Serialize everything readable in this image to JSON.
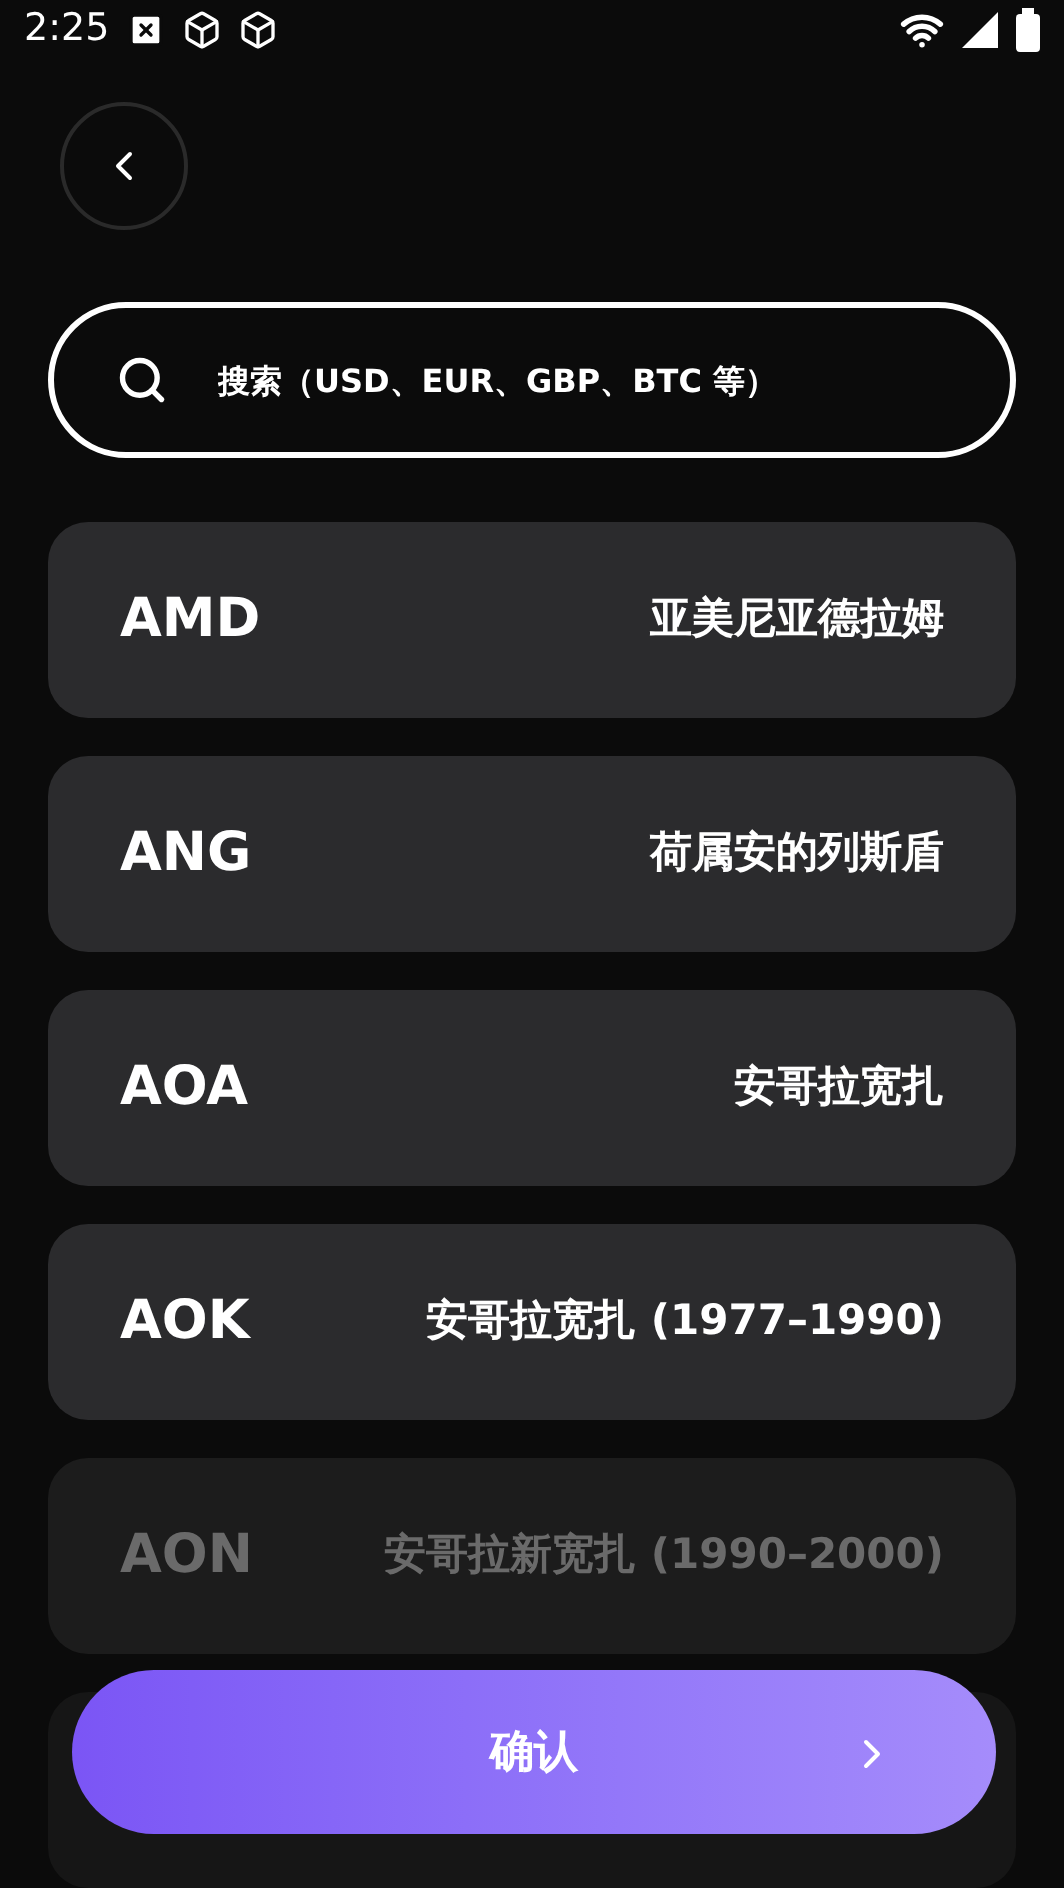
{
  "status_bar": {
    "time": "2:25"
  },
  "search": {
    "placeholder": "搜索（USD、EUR、GBP、BTC 等）"
  },
  "currencies": [
    {
      "code": "AMD",
      "name": "亚美尼亚德拉姆",
      "faded": false
    },
    {
      "code": "ANG",
      "name": "荷属安的列斯盾",
      "faded": false
    },
    {
      "code": "AOA",
      "name": "安哥拉宽扎",
      "faded": false
    },
    {
      "code": "AOK",
      "name": "安哥拉宽扎 (1977–1990)",
      "faded": false
    },
    {
      "code": "AON",
      "name": "安哥拉新宽扎 (1990–2000)",
      "faded": true
    }
  ],
  "confirm_button": {
    "label": "确认"
  }
}
